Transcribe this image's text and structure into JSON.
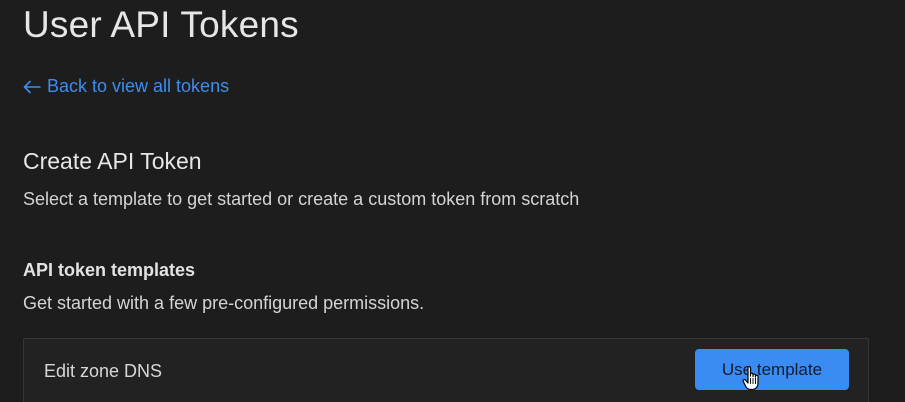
{
  "header": {
    "title": "User API Tokens"
  },
  "back_link": {
    "arrow": "←",
    "label": "Back to view all tokens",
    "icon": "arrow-left-icon",
    "color": "#3b8ef0"
  },
  "create": {
    "title": "Create API Token",
    "description": "Select a template to get started or create a custom token from scratch"
  },
  "templates": {
    "title": "API token templates",
    "description": "Get started with a few pre-configured permissions.",
    "items": [
      {
        "name": "Edit zone DNS",
        "button_label": "Use template"
      }
    ]
  },
  "colors": {
    "background": "#1d1d1d",
    "accent": "#3a8cf2",
    "link": "#3b8ef0"
  },
  "cursor": {
    "icon": "hand-pointer-icon"
  }
}
